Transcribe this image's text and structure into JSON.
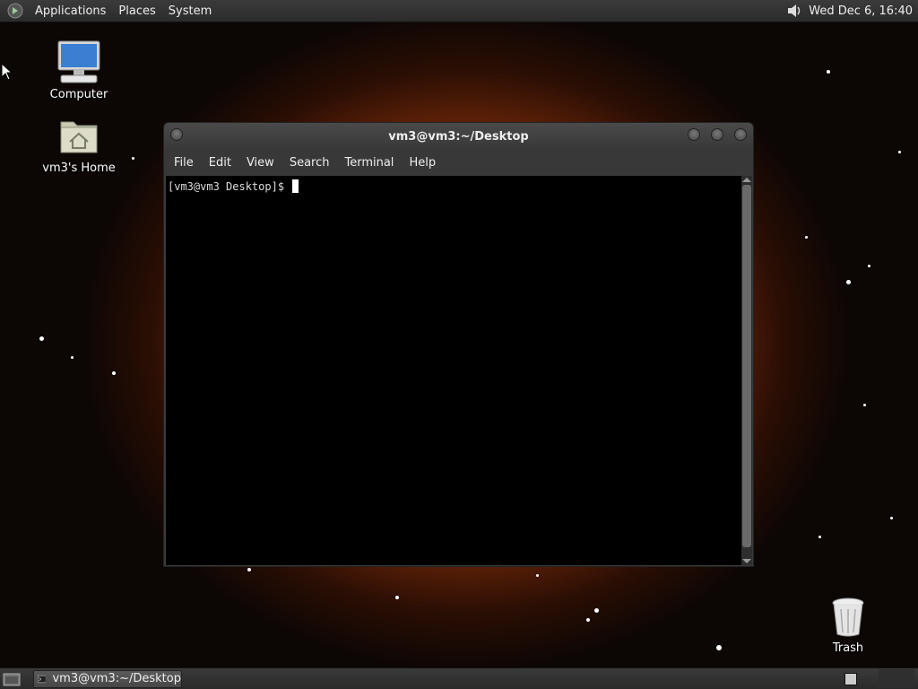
{
  "top_panel": {
    "menus": [
      "Applications",
      "Places",
      "System"
    ],
    "clock": "Wed Dec  6, 16:40"
  },
  "desktop_icons": {
    "computer": "Computer",
    "home": "vm3's Home",
    "trash": "Trash"
  },
  "terminal": {
    "title": "vm3@vm3:~/Desktop",
    "menus": [
      "File",
      "Edit",
      "View",
      "Search",
      "Terminal",
      "Help"
    ],
    "prompt": "[vm3@vm3 Desktop]$ "
  },
  "bottom_panel": {
    "task_label": "vm3@vm3:~/Desktop"
  }
}
